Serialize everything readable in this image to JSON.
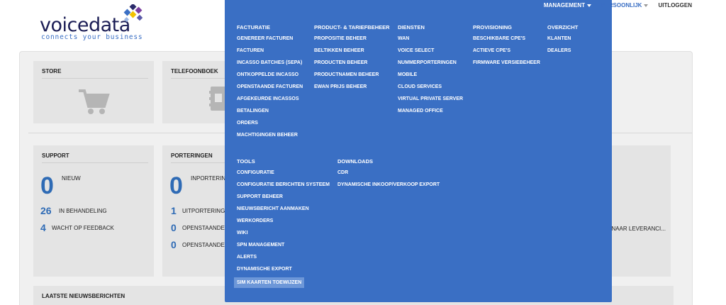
{
  "logo": {
    "name": "voicedata",
    "tagline": "connects your business"
  },
  "topnav": {
    "management": "MANAGEMENT",
    "persoonlijk": "PERSOONLIJK",
    "uitloggen": "UITLOGGEN"
  },
  "cards": {
    "store": {
      "title": "STORE"
    },
    "telefoonboek": {
      "title": "TELEFOONBOEK"
    },
    "support": {
      "title": "SUPPORT",
      "nieuw_count": "0",
      "nieuw_label": "NIEUW",
      "behandeling_count": "26",
      "behandeling_label": "IN BEHANDELING",
      "feedback_count": "4",
      "feedback_label": "WACHT OP FEEDBACK"
    },
    "porteringen": {
      "title": "PORTERINGEN",
      "inportering_count": "0",
      "inportering_label": "INPORTERING",
      "uitportering_count": "1",
      "uitportering_label": "UITPORTERINGEN",
      "openstaande1_count": "0",
      "openstaande1_label": "OPENSTAANDE A",
      "openstaande2_count": "0",
      "openstaande2_label": "OPENSTAANDE D"
    },
    "right_card": {
      "label": "O NAAR LEVERANCI..."
    },
    "news": {
      "title": "LAATSTE NIEUWSBERICHTEN"
    }
  },
  "menu": {
    "facturatie": {
      "header": "FACTURATIE",
      "items": [
        "GENEREER FACTUREN",
        "FACTUREN",
        "INCASSO BATCHES (SEPA)",
        "ONTKOPPELDE INCASSO",
        "OPENSTAANDE FACTUREN",
        "AFGEKEURDE INCASSOS",
        "BETALINGEN",
        "ORDERS",
        "MACHTIGINGEN BEHEER"
      ]
    },
    "product": {
      "header": "PRODUCT- & TARIEFBEHEER",
      "items": [
        "PROPOSITIE BEHEER",
        "BELTIKKEN BEHEER",
        "PRODUCTEN BEHEER",
        "PRODUCTNAMEN BEHEER",
        "EWAN PRIJS BEHEER"
      ]
    },
    "diensten": {
      "header": "DIENSTEN",
      "items": [
        "WAN",
        "VOICE SELECT",
        "NUMMERPORTERINGEN",
        "MOBILE",
        "CLOUD SERVICES",
        "VIRTUAL PRIVATE SERVER",
        "MANAGED OFFICE"
      ]
    },
    "provisioning": {
      "header": "PROVISIONING",
      "items": [
        "BESCHIKBARE CPE'S",
        "ACTIEVE CPE'S",
        "FIRMWARE VERSIEBEHEER"
      ]
    },
    "overzicht": {
      "header": "OVERZICHT",
      "items": [
        "KLANTEN",
        "DEALERS"
      ]
    },
    "tools": {
      "header": "TOOLS",
      "items": [
        "CONFIGURATIE",
        "CONFIGURATIE BERICHTEN SYSTEEM",
        "SUPPORT BEHEER",
        "NIEUWSBERICHT AANMAKEN",
        "WERKORDERS",
        "WIKI",
        "SPN MANAGEMENT",
        "ALERTS",
        "DYNAMISCHE EXPORT",
        "SIM KAARTEN TOEWIJZEN"
      ]
    },
    "downloads": {
      "header": "DOWNLOADS",
      "items": [
        "CDR",
        "DYNAMISCHE INKOOP/VERKOOP EXPORT"
      ]
    }
  },
  "colors": {
    "menu_bg": "#3a6fc4",
    "accent": "#2f6bb5",
    "logo_dark": "#1b1d55"
  }
}
